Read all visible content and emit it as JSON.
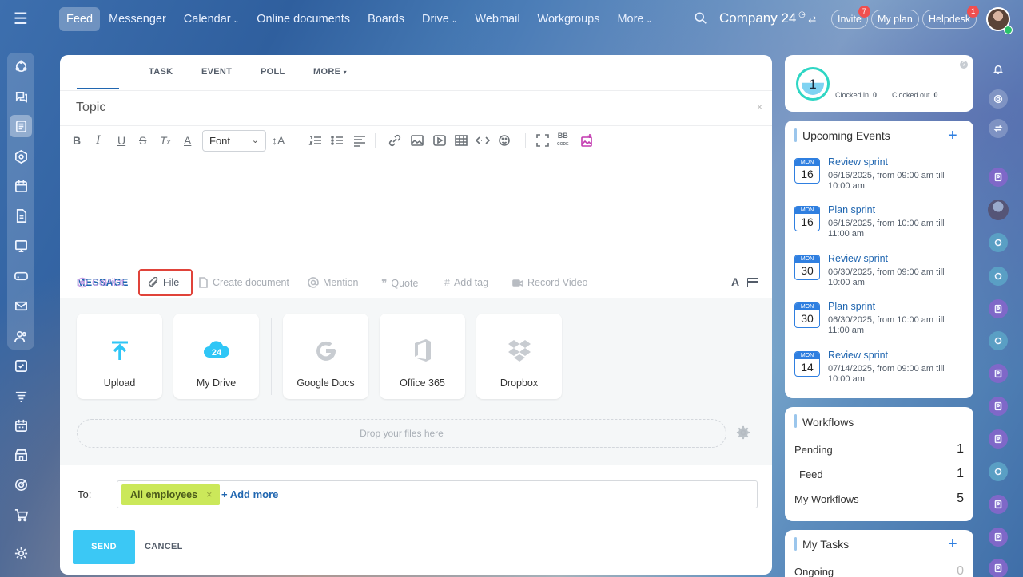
{
  "topnav": {
    "items": [
      {
        "label": "Feed",
        "active": true,
        "caret": false
      },
      {
        "label": "Messenger",
        "caret": false
      },
      {
        "label": "Calendar",
        "caret": true
      },
      {
        "label": "Online documents",
        "caret": false
      },
      {
        "label": "Boards",
        "caret": false
      },
      {
        "label": "Drive",
        "caret": true
      },
      {
        "label": "Webmail",
        "caret": false
      },
      {
        "label": "Workgroups",
        "caret": false
      },
      {
        "label": "More",
        "caret": true
      }
    ],
    "company": "Company 24",
    "invite_label": "Invite",
    "invite_badge": "7",
    "myplan_label": "My plan",
    "helpdesk_label": "Helpdesk",
    "helpdesk_badge": "1"
  },
  "composer": {
    "tabs": [
      "MESSAGE",
      "TASK",
      "EVENT",
      "POLL",
      "MORE"
    ],
    "active_tab": "MESSAGE",
    "topic_placeholder": "Topic",
    "font_label": "Font",
    "actions": {
      "copilot": "CoPilot",
      "file": "File",
      "create_document": "Create document",
      "mention": "Mention",
      "quote": "Quote",
      "add_tag": "Add tag",
      "record_video": "Record Video"
    },
    "sources": [
      "Upload",
      "My Drive",
      "Google Docs",
      "Office 365",
      "Dropbox"
    ],
    "drop_text": "Drop your files here",
    "to_label": "To:",
    "recipient_chip": "All employees",
    "add_more": "+ Add more",
    "send_label": "SEND",
    "cancel_label": "CANCEL"
  },
  "timeman": {
    "count": "1",
    "clocked_in_label": "Clocked in",
    "clocked_in_value": "0",
    "clocked_out_label": "Clocked out",
    "clocked_out_value": "0"
  },
  "events": {
    "title": "Upcoming Events",
    "items": [
      {
        "month": "MON",
        "day": "16",
        "name": "Review sprint",
        "when": "06/16/2025, from 09:00 am till 10:00 am"
      },
      {
        "month": "MON",
        "day": "16",
        "name": "Plan sprint",
        "when": "06/16/2025, from 10:00 am till 11:00 am"
      },
      {
        "month": "MON",
        "day": "30",
        "name": "Review sprint",
        "when": "06/30/2025, from 09:00 am till 10:00 am"
      },
      {
        "month": "MON",
        "day": "30",
        "name": "Plan sprint",
        "when": "06/30/2025, from 10:00 am till 11:00 am"
      },
      {
        "month": "MON",
        "day": "14",
        "name": "Review sprint",
        "when": "07/14/2025, from 09:00 am till 10:00 am"
      }
    ]
  },
  "workflows": {
    "title": "Workflows",
    "rows": [
      {
        "label": "Pending",
        "value": "1"
      },
      {
        "label": "Feed",
        "value": "1"
      },
      {
        "label": "My Workflows",
        "value": "5"
      }
    ]
  },
  "tasks": {
    "title": "My Tasks",
    "rows": [
      {
        "label": "Ongoing",
        "value": "0"
      }
    ]
  },
  "colors": {
    "accent": "#2066b0",
    "send": "#3bc8f5",
    "chip": "#cbe85a",
    "highlight": "#e0433a"
  }
}
